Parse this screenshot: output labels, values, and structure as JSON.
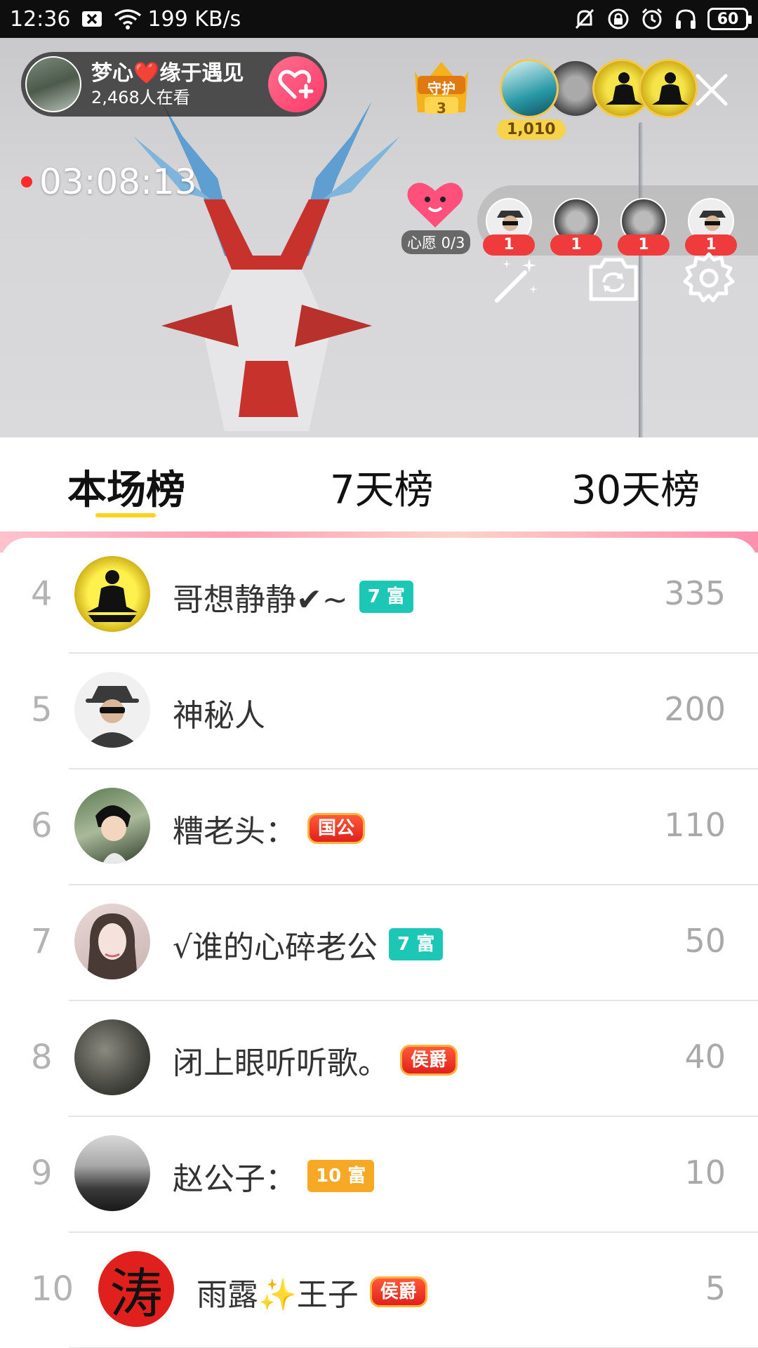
{
  "status": {
    "time": "12:36",
    "speed": "199 KB/s",
    "battery": "60",
    "icons": [
      "close-box-icon",
      "wifi-icon",
      "bell-off-icon",
      "lock-rotate-icon",
      "alarm-icon",
      "headphones-icon",
      "battery-icon"
    ]
  },
  "stream": {
    "host_name": "梦心❤️缘于遇见",
    "viewers": "2,468人在看",
    "guard_label": "守护",
    "guard_count": "3",
    "top_fan_score": "1,010",
    "duration": "03:08:13",
    "wish_label": "心愿 0/3",
    "guests": [
      {
        "count": "1",
        "avatar": "mystery-avatar"
      },
      {
        "count": "1",
        "avatar": "gray-avatar"
      },
      {
        "count": "1",
        "avatar": "gray-avatar"
      },
      {
        "count": "1",
        "avatar": "mystery-avatar"
      }
    ]
  },
  "tabs": [
    "本场榜",
    "7天榜",
    "30天榜"
  ],
  "active_tab": "本场榜",
  "ranking": [
    {
      "rank": "4",
      "name": "哥想静静✔~",
      "badge": "7 富",
      "badge_type": "rich7",
      "score": "335",
      "avatar": "meditation-avatar"
    },
    {
      "rank": "5",
      "name": "神秘人",
      "badge": "",
      "badge_type": "",
      "score": "200",
      "avatar": "mystery-avatar"
    },
    {
      "rank": "6",
      "name": "糟老头：",
      "badge": "国公",
      "badge_type": "noble",
      "score": "110",
      "avatar": "boy-sketch-avatar"
    },
    {
      "rank": "7",
      "name": "√谁的心碎老公",
      "badge": "7 富",
      "badge_type": "rich7",
      "score": "50",
      "avatar": "girl-photo-avatar"
    },
    {
      "rank": "8",
      "name": "闭上眼听听歌。",
      "badge": "侯爵",
      "badge_type": "noble",
      "score": "40",
      "avatar": "dark-photo-avatar"
    },
    {
      "rank": "9",
      "name": "赵公子：",
      "badge": "10 富",
      "badge_type": "rich10",
      "score": "10",
      "avatar": "room-photo-avatar"
    },
    {
      "rank": "10",
      "name": "雨露✨王子",
      "badge": "侯爵",
      "badge_type": "noble",
      "score": "5",
      "avatar_text": "涛"
    }
  ],
  "colors": {
    "accent_yellow": "#ffd21e",
    "rich_badge": "#1cc7b6",
    "rich10_badge": "#f7a925",
    "noble_badge": "#e0201c",
    "follow": "#ff3a6a",
    "guest_count": "#ef3b3b"
  }
}
